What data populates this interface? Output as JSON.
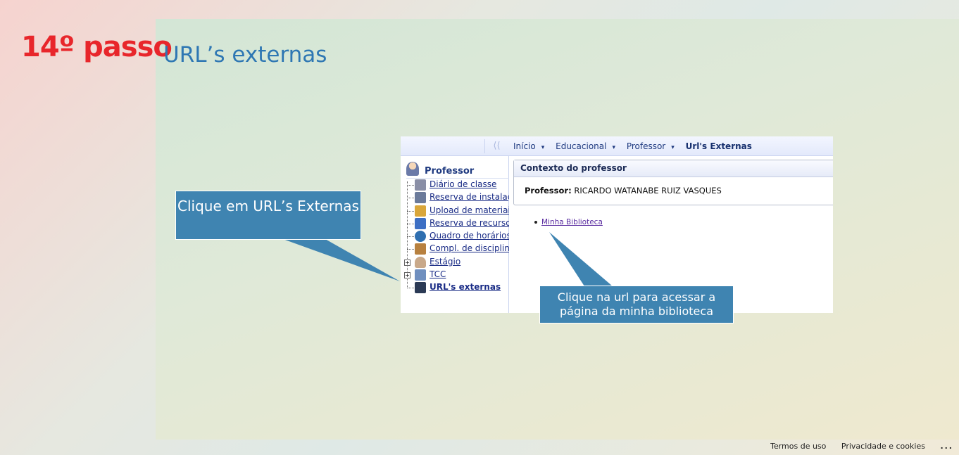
{
  "slide": {
    "step": "14º passo",
    "title": "URL’s externas"
  },
  "window": {
    "collapse_glyph": "⟨⟨",
    "breadcrumb": [
      {
        "label": "Início",
        "caret": "▾"
      },
      {
        "label": "Educacional",
        "caret": "▾"
      },
      {
        "label": "Professor",
        "caret": "▾"
      },
      {
        "label": "Url's Externas",
        "caret": ""
      }
    ],
    "sidebar": {
      "header": "Professor",
      "items": [
        {
          "label": "Diário de classe",
          "icon": "calendar-icon",
          "color": "#8a8fa6"
        },
        {
          "label": "Reserva de instalações",
          "icon": "building-icon",
          "color": "#6b7a9a"
        },
        {
          "label": "Upload de materiais",
          "icon": "upload-icon",
          "color": "#d9a63a"
        },
        {
          "label": "Reserva de recursos",
          "icon": "check-icon",
          "color": "#3d6fc4"
        },
        {
          "label": "Quadro de horários",
          "icon": "clock-icon",
          "color": "#2f6fb0"
        },
        {
          "label": "Compl. de disciplinas",
          "icon": "book-icon",
          "color": "#b7803f"
        },
        {
          "label": "Estágio",
          "icon": "person-icon",
          "color": "#c9a98a"
        },
        {
          "label": "TCC",
          "icon": "document-icon",
          "color": "#6f8fbf"
        },
        {
          "label": "URL's externas",
          "icon": "link-icon",
          "color": "#2b3a55"
        }
      ]
    },
    "context_panel": {
      "title": "Contexto do professor",
      "professor_label": "Professor:",
      "professor_name": "RICARDO WATANABE RUIZ VASQUES"
    },
    "link": "Minha Biblioteca"
  },
  "callouts": {
    "left": "Clique em URL’s Externas",
    "right": "Clique na url para acessar a página da minha biblioteca"
  },
  "footer": {
    "terms": "Termos de uso",
    "privacy": "Privacidade e cookies",
    "more": "..."
  }
}
